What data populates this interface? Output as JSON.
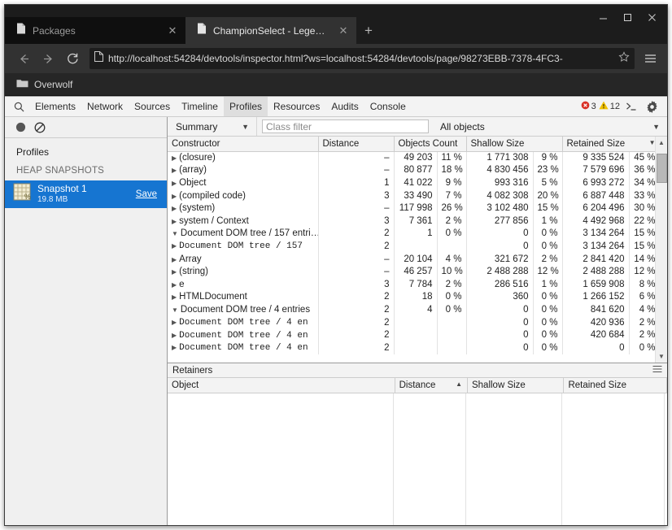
{
  "browser": {
    "window_controls": {
      "minimize": "minimize-icon",
      "maximize": "maximize-icon",
      "close": "close-icon"
    },
    "tabs": [
      {
        "title": "Packages",
        "active": false,
        "favicon": "page-icon",
        "close": "close-icon"
      },
      {
        "title": "ChampionSelect - Legend…",
        "active": true,
        "favicon": "page-icon",
        "close": "close-icon"
      }
    ],
    "new_tab_label": "+",
    "nav": {
      "back": "back-arrow-icon",
      "forward": "forward-arrow-icon",
      "reload": "reload-icon",
      "menu": "hamburger-menu-icon"
    },
    "omnibox": {
      "url": "http://localhost:54284/devtools/inspector.html?ws=localhost:54284/devtools/page/98273EBB-7378-4FC3-",
      "page_icon": "page-icon",
      "bookmark_icon": "star-icon"
    },
    "bookmarks": [
      {
        "label": "Overwolf",
        "icon": "folder-icon"
      }
    ]
  },
  "devtools": {
    "search_icon": "search-icon",
    "tabs": [
      {
        "label": "Elements",
        "selected": false
      },
      {
        "label": "Network",
        "selected": false
      },
      {
        "label": "Sources",
        "selected": false
      },
      {
        "label": "Timeline",
        "selected": false
      },
      {
        "label": "Profiles",
        "selected": true
      },
      {
        "label": "Resources",
        "selected": false
      },
      {
        "label": "Audits",
        "selected": false
      },
      {
        "label": "Console",
        "selected": false
      }
    ],
    "status": {
      "error_count": "3",
      "warning_count": "12",
      "error_icon": "error-circle-icon",
      "warning_icon": "warning-triangle-icon",
      "console_icon": "console-prompt-icon",
      "settings_icon": "gear-icon"
    }
  },
  "profiles_panel": {
    "record_icon": "record-circle-icon",
    "clear_icon": "clear-prohibited-icon",
    "header": "Profiles",
    "section_title": "HEAP SNAPSHOTS",
    "snapshot": {
      "icon": "snapshot-grid-icon",
      "name": "Snapshot 1",
      "size": "19.8 MB",
      "save_label": "Save"
    }
  },
  "heap_toolbar": {
    "view_select": "Summary",
    "view_caret": "▼",
    "class_filter_placeholder": "Class filter",
    "class_filter_value": "",
    "objects_select": "All objects",
    "objects_caret": "▼"
  },
  "heap_grid": {
    "columns": [
      "Constructor",
      "Distance",
      "Objects Count",
      "Shallow Size",
      "Retained Size"
    ],
    "sorted_column": "Retained Size",
    "sort_caret": "▼",
    "rows": [
      {
        "constructor": "(closure)",
        "expander": "▶",
        "mono": false,
        "indent": 0,
        "distance": "–",
        "count": "49 203",
        "count_pct": "11 %",
        "shallow": "1 771 308",
        "shallow_pct": "9 %",
        "retained": "9 335 524",
        "retained_pct": "45 %"
      },
      {
        "constructor": "(array)",
        "expander": "▶",
        "mono": false,
        "indent": 0,
        "distance": "–",
        "count": "80 877",
        "count_pct": "18 %",
        "shallow": "4 830 456",
        "shallow_pct": "23 %",
        "retained": "7 579 696",
        "retained_pct": "36 %"
      },
      {
        "constructor": "Object",
        "expander": "▶",
        "mono": false,
        "indent": 0,
        "distance": "1",
        "count": "41 022",
        "count_pct": "9 %",
        "shallow": "993 316",
        "shallow_pct": "5 %",
        "retained": "6 993 272",
        "retained_pct": "34 %"
      },
      {
        "constructor": "(compiled code)",
        "expander": "▶",
        "mono": false,
        "indent": 0,
        "distance": "3",
        "count": "33 490",
        "count_pct": "7 %",
        "shallow": "4 082 308",
        "shallow_pct": "20 %",
        "retained": "6 887 448",
        "retained_pct": "33 %"
      },
      {
        "constructor": "(system)",
        "expander": "▶",
        "mono": false,
        "indent": 0,
        "distance": "–",
        "count": "117 998",
        "count_pct": "26 %",
        "shallow": "3 102 480",
        "shallow_pct": "15 %",
        "retained": "6 204 496",
        "retained_pct": "30 %"
      },
      {
        "constructor": "system / Context",
        "expander": "▶",
        "mono": false,
        "indent": 0,
        "distance": "3",
        "count": "7 361",
        "count_pct": "2 %",
        "shallow": "277 856",
        "shallow_pct": "1 %",
        "retained": "4 492 968",
        "retained_pct": "22 %"
      },
      {
        "constructor": "Document DOM tree / 157 entri…",
        "expander": "▼",
        "mono": false,
        "indent": 0,
        "distance": "2",
        "count": "1",
        "count_pct": "0 %",
        "shallow": "0",
        "shallow_pct": "0 %",
        "retained": "3 134 264",
        "retained_pct": "15 %"
      },
      {
        "constructor": "Document DOM tree / 157",
        "expander": "▶",
        "mono": true,
        "indent": 1,
        "distance": "2",
        "count": "",
        "count_pct": "",
        "shallow": "0",
        "shallow_pct": "0 %",
        "retained": "3 134 264",
        "retained_pct": "15 %"
      },
      {
        "constructor": "Array",
        "expander": "▶",
        "mono": false,
        "indent": 0,
        "distance": "–",
        "count": "20 104",
        "count_pct": "4 %",
        "shallow": "321 672",
        "shallow_pct": "2 %",
        "retained": "2 841 420",
        "retained_pct": "14 %"
      },
      {
        "constructor": "(string)",
        "expander": "▶",
        "mono": false,
        "indent": 0,
        "distance": "–",
        "count": "46 257",
        "count_pct": "10 %",
        "shallow": "2 488 288",
        "shallow_pct": "12 %",
        "retained": "2 488 288",
        "retained_pct": "12 %"
      },
      {
        "constructor": "e",
        "expander": "▶",
        "mono": false,
        "indent": 0,
        "distance": "3",
        "count": "7 784",
        "count_pct": "2 %",
        "shallow": "286 516",
        "shallow_pct": "1 %",
        "retained": "1 659 908",
        "retained_pct": "8 %"
      },
      {
        "constructor": "HTMLDocument",
        "expander": "▶",
        "mono": false,
        "indent": 0,
        "distance": "2",
        "count": "18",
        "count_pct": "0 %",
        "shallow": "360",
        "shallow_pct": "0 %",
        "retained": "1 266 152",
        "retained_pct": "6 %"
      },
      {
        "constructor": "Document DOM tree / 4 entries",
        "expander": "▼",
        "mono": false,
        "indent": 0,
        "distance": "2",
        "count": "4",
        "count_pct": "0 %",
        "shallow": "0",
        "shallow_pct": "0 %",
        "retained": "841 620",
        "retained_pct": "4 %"
      },
      {
        "constructor": "Document DOM tree / 4 en",
        "expander": "▶",
        "mono": true,
        "indent": 1,
        "distance": "2",
        "count": "",
        "count_pct": "",
        "shallow": "0",
        "shallow_pct": "0 %",
        "retained": "420 936",
        "retained_pct": "2 %"
      },
      {
        "constructor": "Document DOM tree / 4 en",
        "expander": "▶",
        "mono": true,
        "indent": 1,
        "distance": "2",
        "count": "",
        "count_pct": "",
        "shallow": "0",
        "shallow_pct": "0 %",
        "retained": "420 684",
        "retained_pct": "2 %"
      },
      {
        "constructor": "Document DOM tree / 4 en",
        "expander": "▶",
        "mono": true,
        "indent": 1,
        "distance": "2",
        "count": "",
        "count_pct": "",
        "shallow": "0",
        "shallow_pct": "0 %",
        "retained": "0",
        "retained_pct": "0 %"
      }
    ],
    "scrollbar": {
      "up": "▲",
      "down": "▼"
    }
  },
  "retainers": {
    "title": "Retainers",
    "menu_icon": "options-menu-icon",
    "columns": [
      "Object",
      "Distance",
      "Shallow Size",
      "Retained Size"
    ],
    "sorted_column": "Distance",
    "sort_caret": "▲",
    "rows": []
  },
  "colors": {
    "chrome_dark": "#1c1c1c",
    "toolbar": "#323232",
    "selection_blue": "#1675d1",
    "panel_bg": "#f3f3f3",
    "error_red": "#d93025",
    "warning_yellow": "#f0c000"
  }
}
